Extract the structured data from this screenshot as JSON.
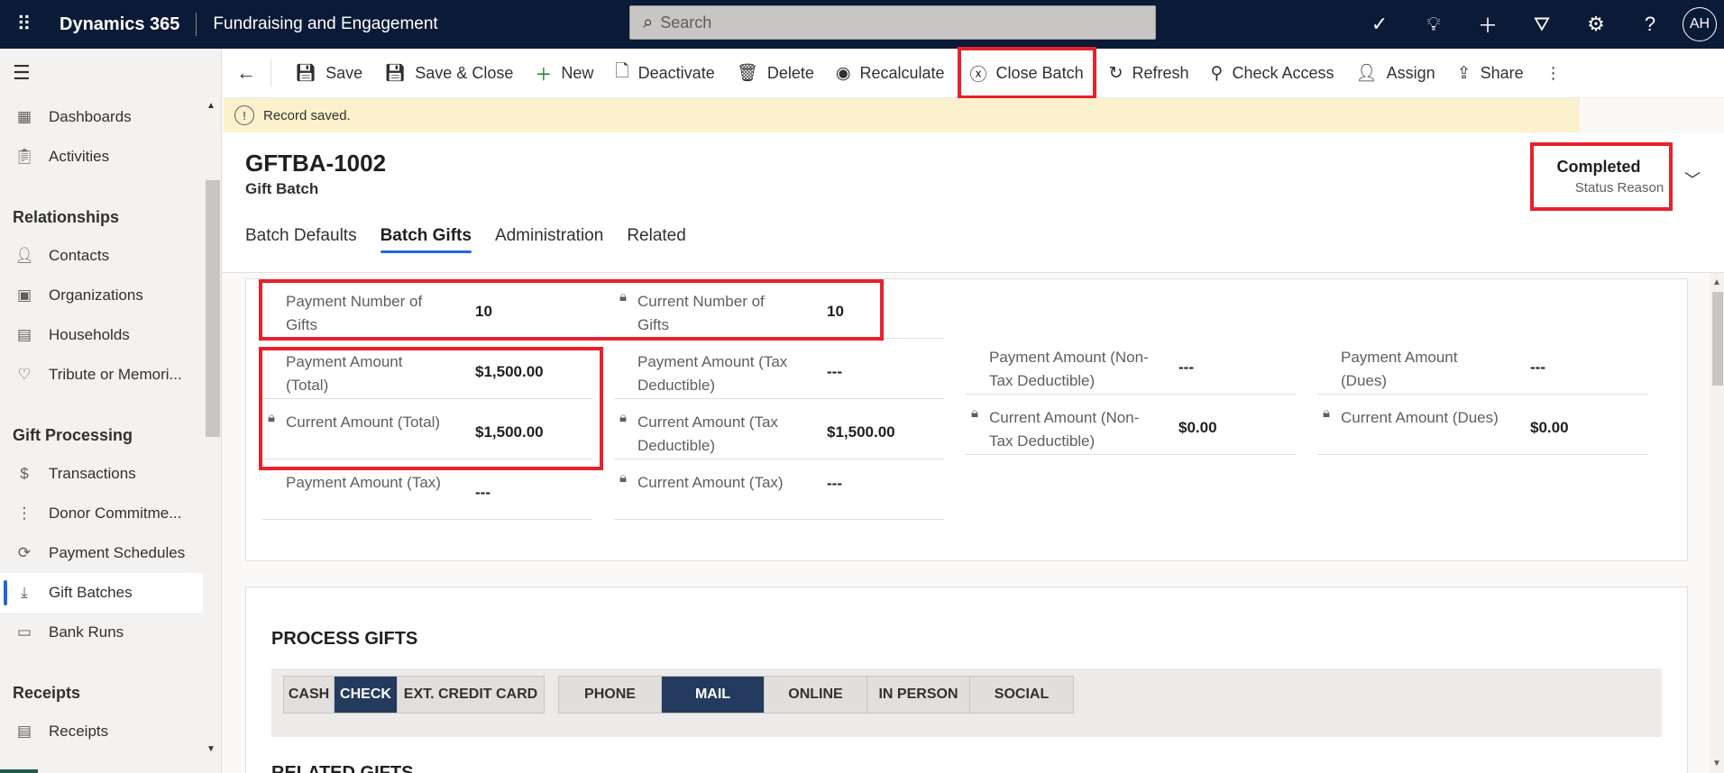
{
  "topbar": {
    "app_name": "Dynamics 365",
    "area_name": "Fundraising and Engagement",
    "search_placeholder": "Search",
    "avatar_initials": "AH"
  },
  "sidebar": {
    "items_top": [
      {
        "label": "Dashboards",
        "icon": "dashboard-icon"
      },
      {
        "label": "Activities",
        "icon": "clipboard-icon"
      }
    ],
    "groups": [
      {
        "title": "Relationships",
        "items": [
          {
            "label": "Contacts",
            "icon": "person-icon"
          },
          {
            "label": "Organizations",
            "icon": "building-icon"
          },
          {
            "label": "Households",
            "icon": "household-icon"
          },
          {
            "label": "Tribute or Memori...",
            "icon": "heart-icon"
          }
        ]
      },
      {
        "title": "Gift Processing",
        "items": [
          {
            "label": "Transactions",
            "icon": "money-icon"
          },
          {
            "label": "Donor Commitme...",
            "icon": "commitment-icon"
          },
          {
            "label": "Payment Schedules",
            "icon": "schedule-icon"
          },
          {
            "label": "Gift Batches",
            "icon": "batch-icon"
          },
          {
            "label": "Bank Runs",
            "icon": "bank-run-icon"
          }
        ]
      },
      {
        "title": "Receipts",
        "items": [
          {
            "label": "Receipts",
            "icon": "receipt-icon"
          }
        ]
      }
    ]
  },
  "commands": {
    "save": "Save",
    "save_close": "Save & Close",
    "new": "New",
    "deactivate": "Deactivate",
    "delete": "Delete",
    "recalculate": "Recalculate",
    "close_batch": "Close Batch",
    "refresh": "Refresh",
    "check_access": "Check Access",
    "assign": "Assign",
    "share": "Share"
  },
  "notification": {
    "text": "Record saved."
  },
  "record": {
    "title": "GFTBA-1002",
    "type": "Gift Batch",
    "status_value": "Completed",
    "status_label": "Status Reason"
  },
  "tabs": [
    "Batch Defaults",
    "Batch Gifts",
    "Administration",
    "Related"
  ],
  "fields": {
    "payment_number_of_gifts": {
      "label": "Payment Number of Gifts",
      "value": "10"
    },
    "current_number_of_gifts": {
      "label": "Current Number of Gifts",
      "value": "10"
    },
    "payment_amount_total": {
      "label": "Payment Amount (Total)",
      "value": "$1,500.00"
    },
    "payment_amount_tax_deductible": {
      "label": "Payment Amount (Tax Deductible)",
      "value": "---"
    },
    "payment_amount_non_tax": {
      "label": "Payment Amount (Non-Tax Deductible)",
      "value": "---"
    },
    "payment_amount_dues": {
      "label": "Payment Amount (Dues)",
      "value": "---"
    },
    "current_amount_total": {
      "label": "Current Amount (Total)",
      "value": "$1,500.00"
    },
    "current_amount_tax_deductible": {
      "label": "Current Amount (Tax Deductible)",
      "value": "$1,500.00"
    },
    "current_amount_non_tax": {
      "label": "Current Amount (Non-Tax Deductible)",
      "value": "$0.00"
    },
    "current_amount_dues": {
      "label": "Current Amount (Dues)",
      "value": "$0.00"
    },
    "payment_amount_tax": {
      "label": "Payment Amount (Tax)",
      "value": "---"
    },
    "current_amount_tax": {
      "label": "Current Amount (Tax)",
      "value": "---"
    }
  },
  "process_gifts": {
    "title": "PROCESS GIFTS",
    "payment_types": [
      "CASH",
      "CHECK",
      "EXT. CREDIT CARD"
    ],
    "payment_selected": "CHECK",
    "channels": [
      "PHONE",
      "MAIL",
      "ONLINE",
      "IN PERSON",
      "SOCIAL"
    ],
    "channel_selected": "MAIL",
    "next_section": "RELATED GIFTS"
  },
  "colors": {
    "highlight": "#e8212d",
    "accent": "#2266e3",
    "nav_dark": "#0b1a36",
    "selected_option": "#243a5e"
  }
}
